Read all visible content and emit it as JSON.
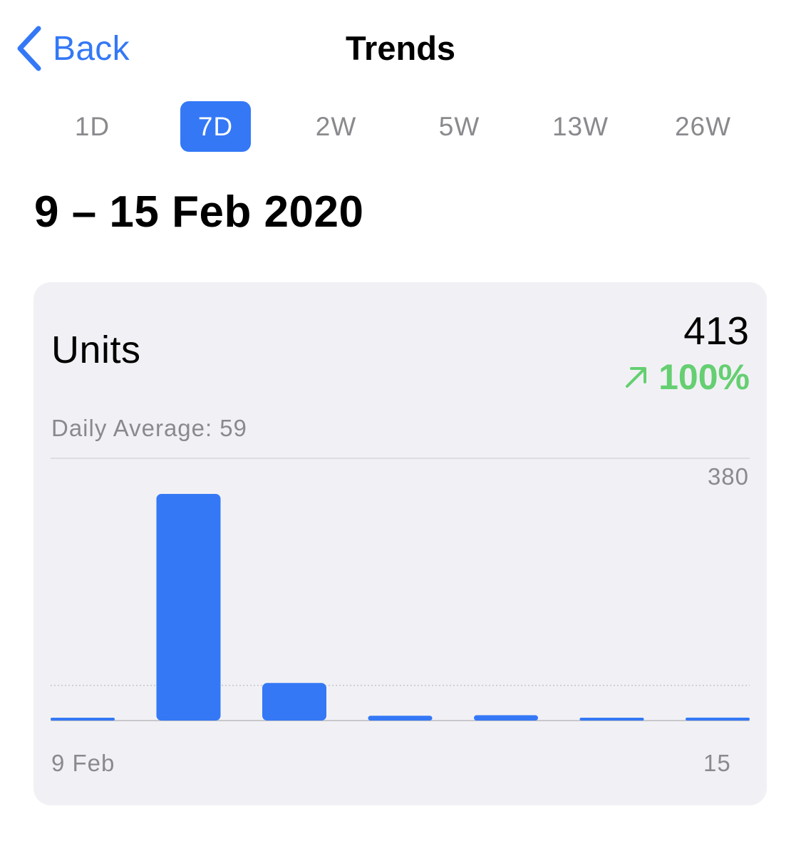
{
  "nav": {
    "back_label": "Back",
    "title": "Trends"
  },
  "ranges": {
    "options": [
      "1D",
      "7D",
      "2W",
      "5W",
      "13W",
      "26W"
    ],
    "selected": "7D"
  },
  "date_range": "9 – 15 Feb 2020",
  "card": {
    "metric": "Units",
    "total": "413",
    "change_percent": "100%",
    "change_direction": "up",
    "daily_average_label": "Daily Average:",
    "daily_average_value": "59",
    "x_start_label": "9 Feb",
    "x_end_label": "15",
    "y_max_label": "380"
  },
  "colors": {
    "accent": "#3478f6",
    "positive": "#65cf71",
    "card_background": "#f1f1f5",
    "secondary_text": "#8a8a8e"
  },
  "chart_data": {
    "type": "bar",
    "categories": [
      "9 Feb",
      "10 Feb",
      "11 Feb",
      "12 Feb",
      "13 Feb",
      "14 Feb",
      "15 Feb"
    ],
    "values": [
      4,
      380,
      63,
      8,
      9,
      4,
      5
    ],
    "average": 59,
    "ylim": [
      0,
      380
    ],
    "y_tick_labels": [
      "380"
    ],
    "x_tick_labels": [
      "9 Feb",
      "15"
    ]
  }
}
